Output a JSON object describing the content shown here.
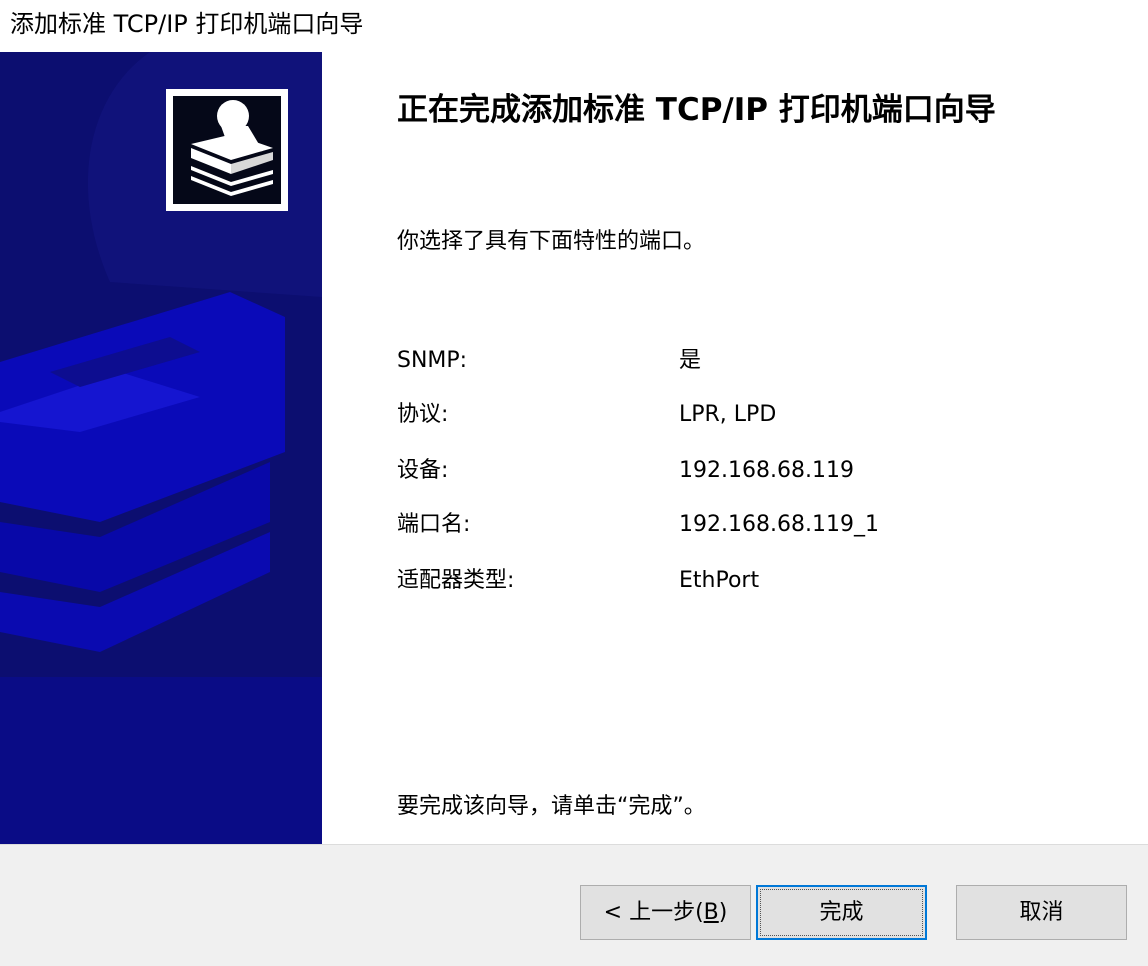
{
  "window": {
    "title": "添加标准 TCP/IP 打印机端口向导"
  },
  "banner": {
    "logo_icon": "printer-icon",
    "background_color": "#0a0c86"
  },
  "content": {
    "heading": "正在完成添加标准 TCP/IP 打印机端口向导",
    "intro": "你选择了具有下面特性的端口。",
    "properties": [
      {
        "label": "SNMP:",
        "value": "是"
      },
      {
        "label": "协议:",
        "value": "LPR, LPD"
      },
      {
        "label": "设备:",
        "value": "192.168.68.119"
      },
      {
        "label": "端口名:",
        "value": "192.168.68.119_1"
      },
      {
        "label": "适配器类型:",
        "value": "EthPort"
      }
    ],
    "finish_hint": "要完成该向导，请单击“完成”。"
  },
  "buttons": {
    "back_prefix": "< 上一步(",
    "back_accel": "B",
    "back_suffix": ")",
    "finish": "完成",
    "cancel": "取消"
  },
  "colors": {
    "focus_border": "#0078d7",
    "button_face": "#e1e1e1",
    "footer_background": "#f0f0f0"
  }
}
